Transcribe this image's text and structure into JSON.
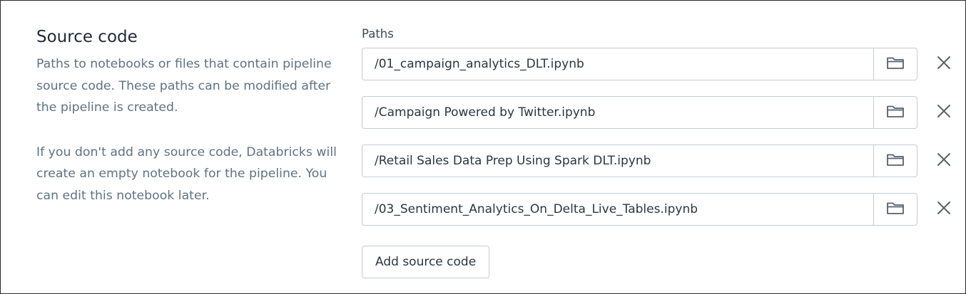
{
  "section": {
    "title": "Source code",
    "description_1": "Paths to notebooks or files that contain pipeline source code. These paths can be modified after the pipeline is created.",
    "description_2": "If you don't add any source code, Databricks will create an empty notebook for the pipeline. You can edit this notebook later."
  },
  "paths": {
    "label": "Paths",
    "items": [
      {
        "value": "/01_campaign_analytics_DLT.ipynb"
      },
      {
        "value": "/Campaign Powered by Twitter.ipynb"
      },
      {
        "value": "/Retail Sales Data Prep Using Spark DLT.ipynb"
      },
      {
        "value": "/03_Sentiment_Analytics_On_Delta_Live_Tables.ipynb"
      }
    ],
    "browse_icon": "folder-icon",
    "remove_icon": "close-icon"
  },
  "add_button": {
    "label": "Add source code"
  },
  "colors": {
    "title": "#1f2a36",
    "description": "#5f7385",
    "border": "#c5ccd3",
    "icon": "#55636f"
  }
}
